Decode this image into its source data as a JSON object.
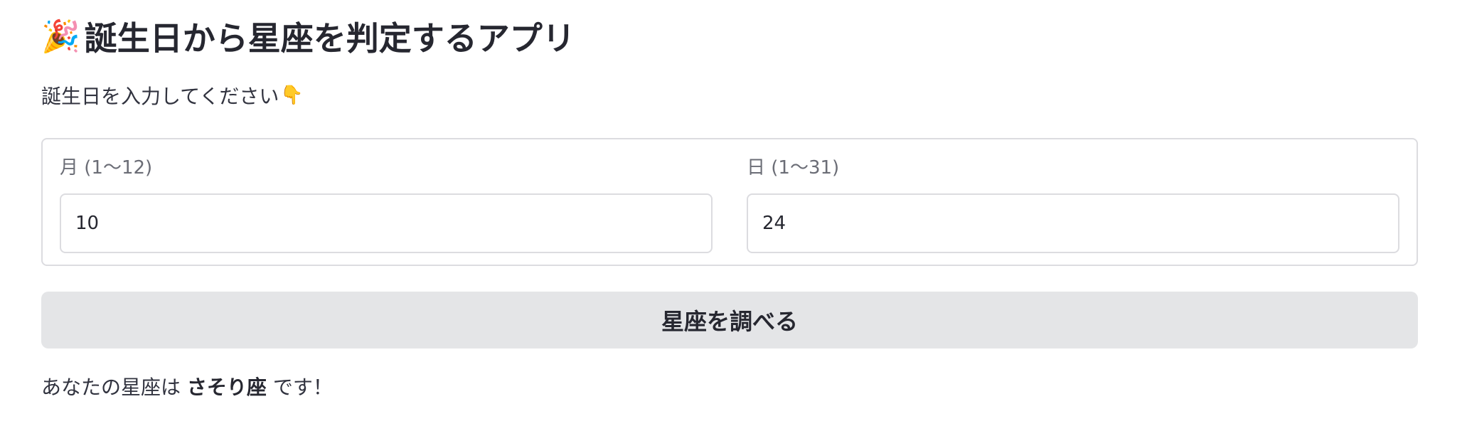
{
  "header": {
    "emoji": "🎉",
    "title": "誕生日から星座を判定するアプリ"
  },
  "prompt": {
    "text": "誕生日を入力してください",
    "emoji": "👇"
  },
  "form": {
    "month": {
      "label": "月 (1〜12)",
      "value": "10"
    },
    "day": {
      "label": "日 (1〜31)",
      "value": "24"
    },
    "submit_label": "星座を調べる"
  },
  "result": {
    "prefix": "あなたの星座は ",
    "sign": "さそり座",
    "suffix": " です！"
  }
}
